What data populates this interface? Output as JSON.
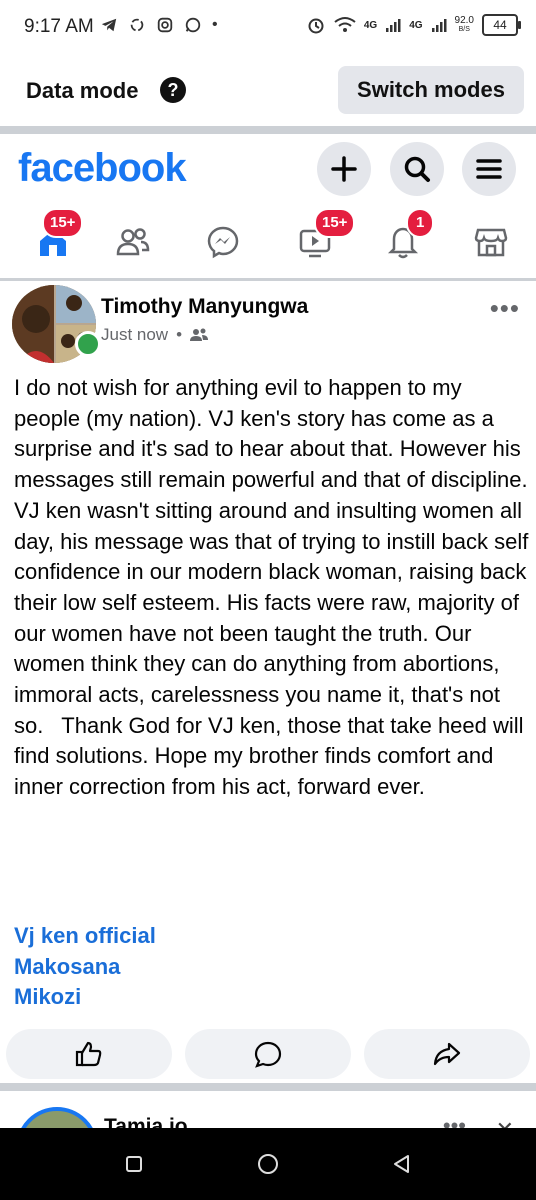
{
  "status_bar": {
    "time": "9:17 AM",
    "network_left": "4G",
    "network_right": "4G",
    "speed_value": "92.0",
    "speed_unit": "B/S",
    "battery": "44"
  },
  "data_mode": {
    "label": "Data mode",
    "help_icon": "?",
    "switch_label": "Switch modes"
  },
  "header": {
    "logo": "facebook",
    "tabs": [
      {
        "name": "home",
        "icon": "home-icon",
        "badge": "15+"
      },
      {
        "name": "friends",
        "icon": "friends-icon",
        "badge": ""
      },
      {
        "name": "messenger",
        "icon": "messenger-icon",
        "badge": ""
      },
      {
        "name": "video",
        "icon": "video-icon",
        "badge": "15+"
      },
      {
        "name": "notifications",
        "icon": "bell-icon",
        "badge": "1"
      },
      {
        "name": "marketplace",
        "icon": "marketplace-icon",
        "badge": ""
      }
    ]
  },
  "post": {
    "author": "Timothy Manyungwa",
    "time": "Just now",
    "separator": "•",
    "text": "I do not wish for anything evil to happen to my people (my nation). VJ ken's story has come as a surprise and it's sad to hear about that. However his messages still remain powerful and that of discipline.  VJ ken wasn't sitting around and insulting women all day, his message was that of trying to instill back self confidence in our modern black woman, raising back their low self esteem. His facts were raw, majority of our women have not been taught the truth. Our women think they can do anything from abortions, immoral acts, carelessness you name it, that's not so.   Thank God for VJ ken, those that take heed will find solutions. Hope my brother finds comfort and inner correction from his act, forward ever.",
    "tags": [
      "Vj ken official",
      "Makosana",
      "Mikozi"
    ]
  },
  "next_post": {
    "author": "Tamia io"
  },
  "colors": {
    "brand": "#1877f2",
    "badge": "#e41e3f",
    "link": "#1a6ed8",
    "online": "#31a24c"
  }
}
